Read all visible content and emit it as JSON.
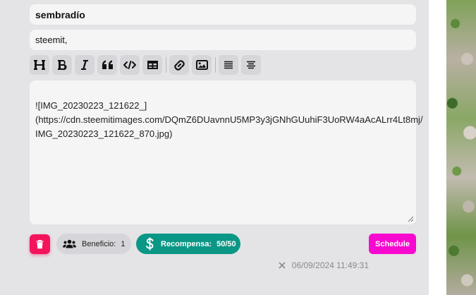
{
  "post": {
    "title": "sembradío",
    "tags": "steemit,",
    "body_lines": [
      "![IMG_20230223_121622_]",
      "(https://cdn.steemitimages.com/DQmZ6DUavnnU5MP3y3jGNhGUuhiF3UoRW4aAcALrr4Lt8mj/",
      "IMG_20230223_121622_870.jpg)"
    ]
  },
  "toolbar": {
    "buttons": [
      "heading-icon",
      "bold-icon",
      "italic-icon",
      "quote-icon",
      "code-icon",
      "table-icon",
      "link-icon",
      "image-icon",
      "align-justify-icon",
      "align-center-icon"
    ]
  },
  "footer": {
    "beneficio_label": "Beneficio:",
    "beneficio_value": "1",
    "recompensa_label": "Recompensa:",
    "recompensa_value": "50/50",
    "schedule_label": "Schedule",
    "date": "06/09/2024 11:49:31"
  },
  "colors": {
    "background": "#e4e3e6",
    "field": "#f5f5f5",
    "delete": "#f3145c",
    "recompensa": "#0b9785",
    "schedule": "#f809cf"
  }
}
